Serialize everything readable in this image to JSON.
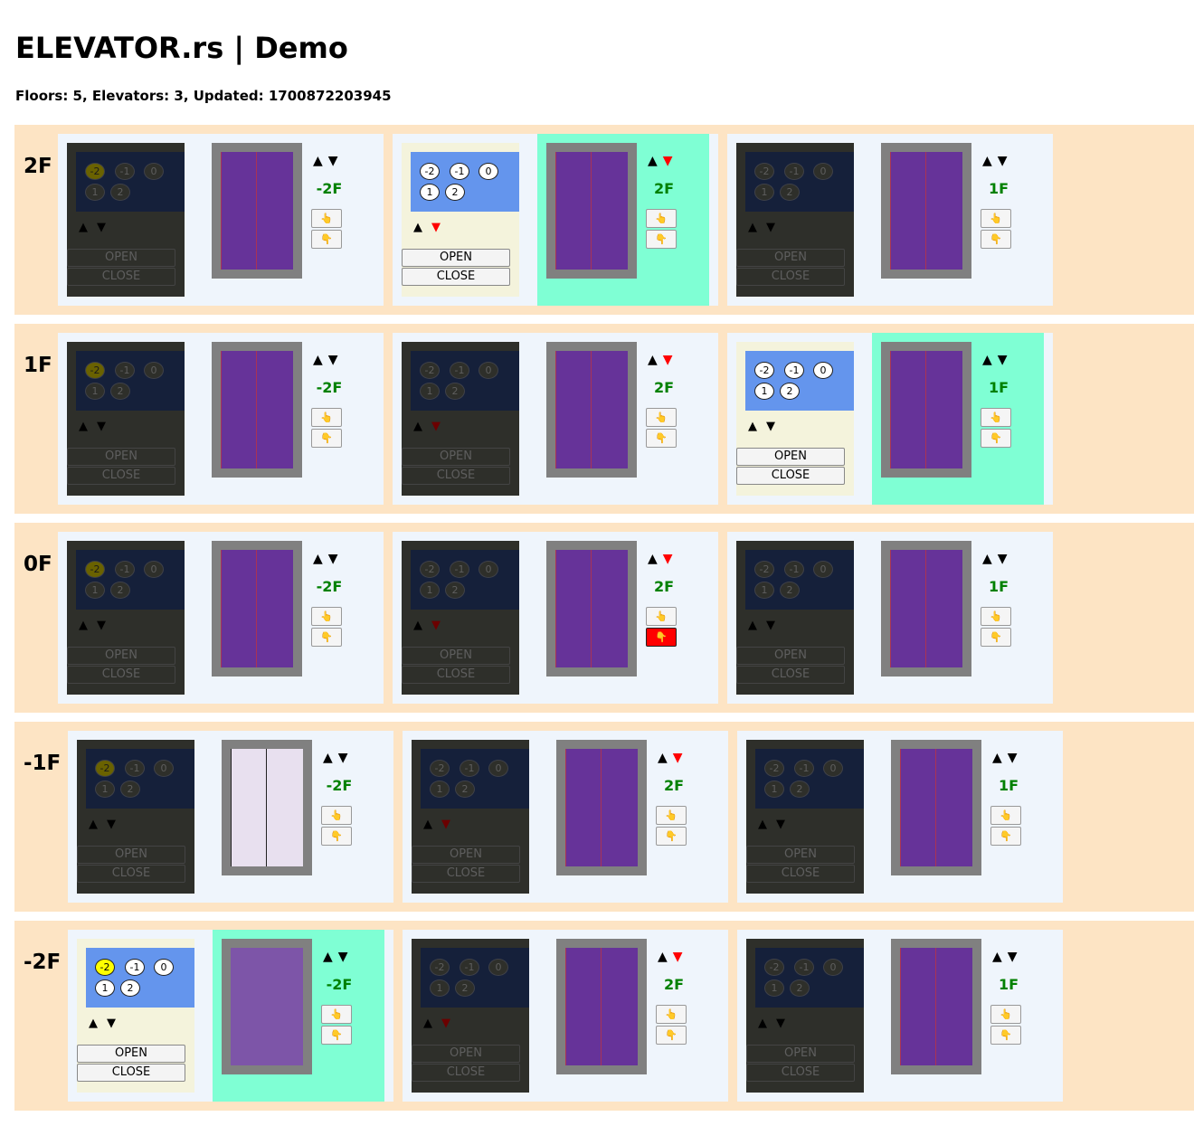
{
  "title": "ELEVATOR.rs | Demo",
  "status": "Floors: 5, Elevators: 3, Updated: 1700872203945",
  "labels": {
    "floor_buttons": [
      "-2",
      "-1",
      "0",
      "1",
      "2"
    ],
    "open": "OPEN",
    "close": "CLOSE",
    "up_arrow": "▲",
    "down_arrow": "▼",
    "call_up_icon": "👆",
    "call_down_icon": "👇"
  },
  "elevators": [
    {
      "id": 1,
      "position": "-2F",
      "current_floor": "-2F",
      "selected_floors": [
        "-2"
      ],
      "down_active": false,
      "door": "opening"
    },
    {
      "id": 2,
      "position": "2F",
      "current_floor": "2F",
      "selected_floors": [],
      "down_active": true,
      "door": "closed"
    },
    {
      "id": 3,
      "position": "1F",
      "current_floor": "1F",
      "selected_floors": [],
      "down_active": false,
      "door": "closed"
    }
  ],
  "floors": [
    {
      "label": "2F",
      "opened_door_elevator": null,
      "lit_call": null
    },
    {
      "label": "1F",
      "opened_door_elevator": null,
      "lit_call": null
    },
    {
      "label": "0F",
      "opened_door_elevator": null,
      "lit_call": {
        "elevator": 2,
        "direction": "down"
      }
    },
    {
      "label": "-1F",
      "opened_door_elevator": 1,
      "lit_call": null
    },
    {
      "label": "-2F",
      "opened_door_elevator": null,
      "lit_call": null
    }
  ],
  "colors": {
    "floor_row": "#fde4c4",
    "car_panel": "#eff5fc",
    "active_panel": "#f4f3dc",
    "active_display": "#6495ed",
    "shaft_highlight": "#7fffd4",
    "door": "#663399",
    "position_text": "#008000",
    "alert": "#ff0000"
  }
}
